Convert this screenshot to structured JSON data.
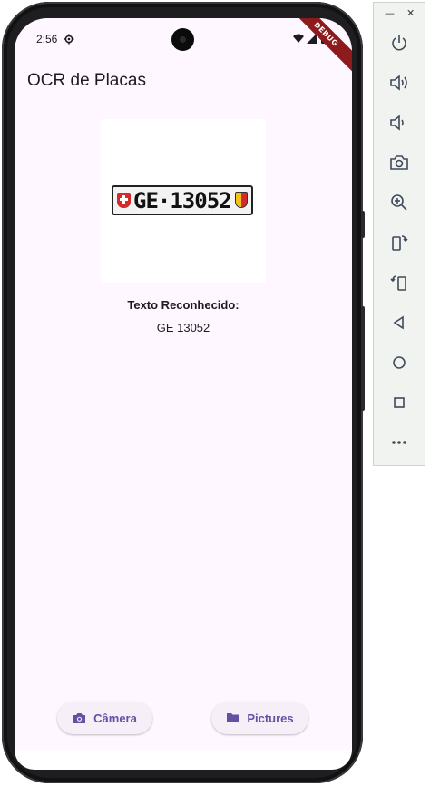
{
  "status_bar": {
    "time": "2:56"
  },
  "debug_banner": "DEBUG",
  "app_bar": {
    "title": "OCR de Placas"
  },
  "plate_image": {
    "text": "GE·13052"
  },
  "result": {
    "heading": "Texto Reconhecido:",
    "value": "GE 13052"
  },
  "buttons": {
    "camera": "Câmera",
    "pictures": "Pictures"
  },
  "colors": {
    "background": "#fef7ff",
    "primary": "#6750a4",
    "button_bg": "#f6eff8"
  },
  "emulator_toolbar": {
    "window_controls": [
      "minimize-icon",
      "close-icon"
    ],
    "tools": [
      "power-icon",
      "volume-up-icon",
      "volume-down-icon",
      "screenshot-icon",
      "zoom-icon",
      "rotate-left-icon",
      "rotate-right-icon",
      "back-icon",
      "home-icon",
      "overview-icon",
      "more-icon"
    ]
  }
}
